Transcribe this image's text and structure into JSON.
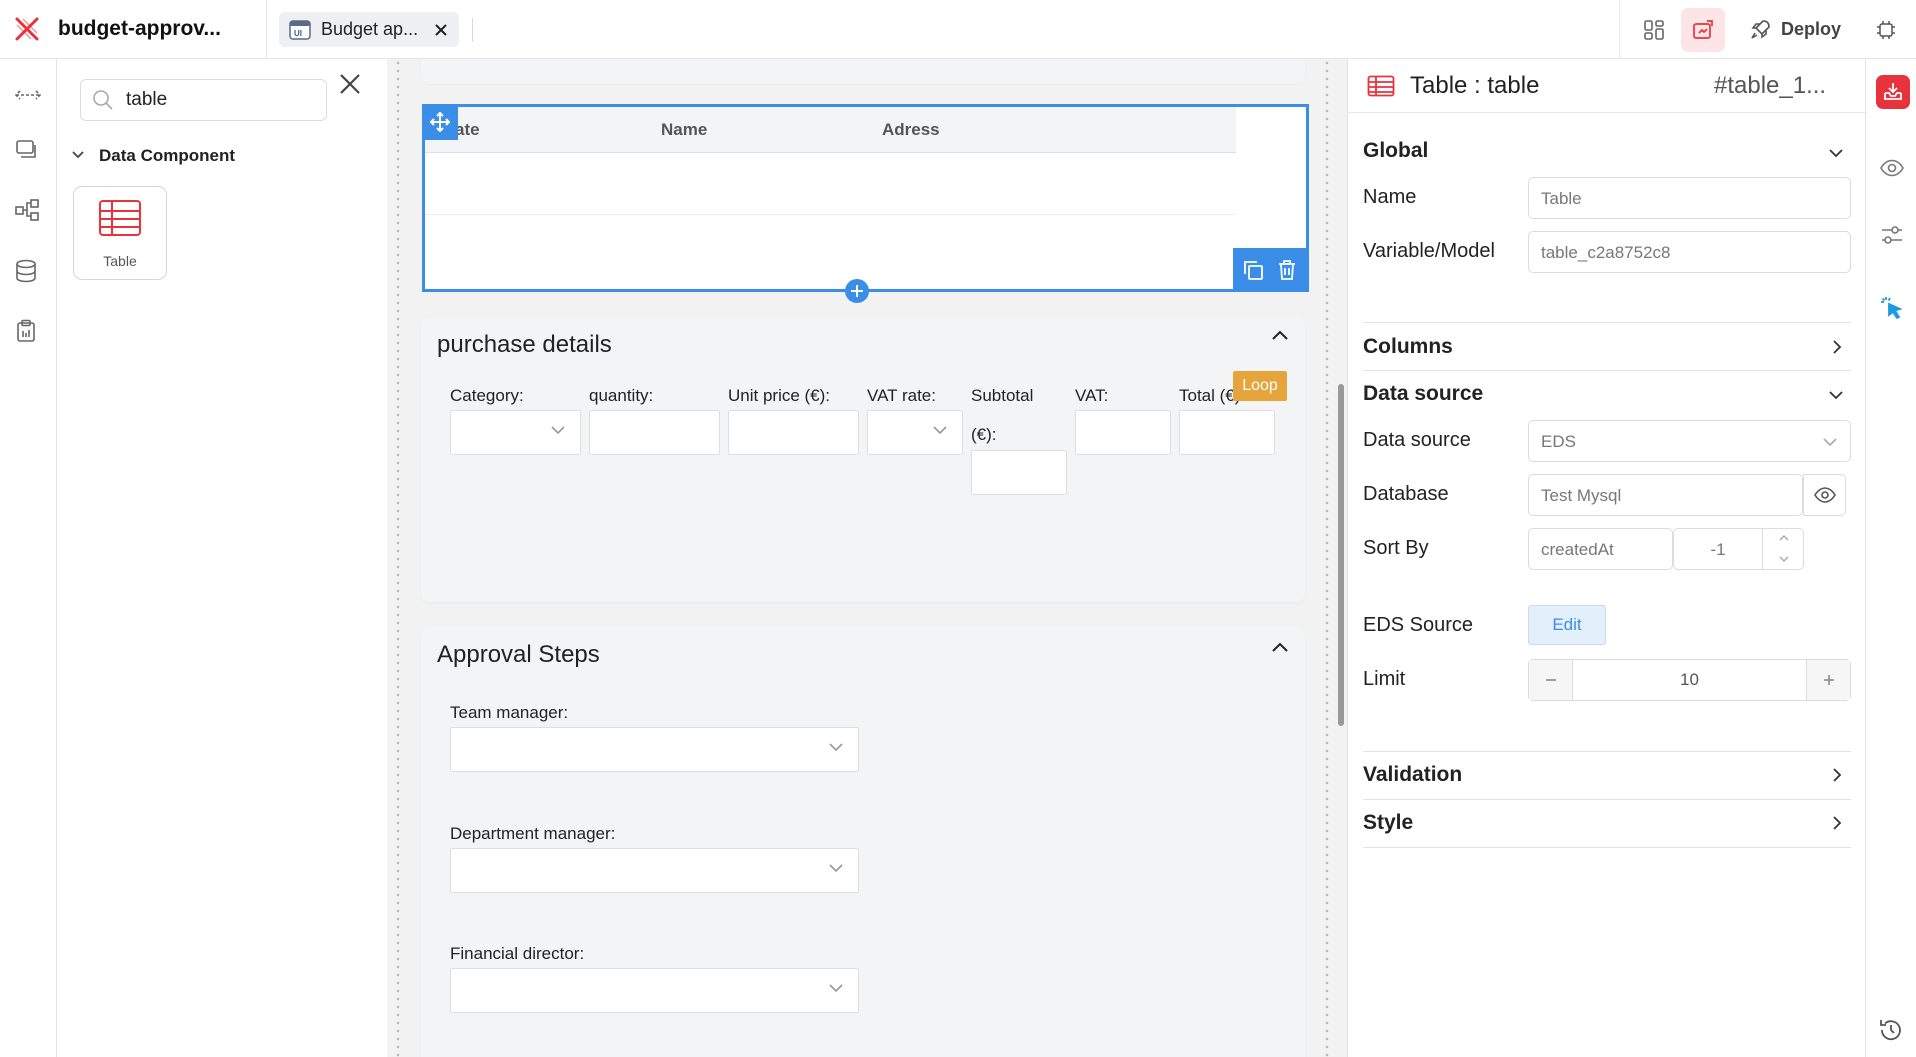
{
  "app": {
    "title": "budget-approv..."
  },
  "tab": {
    "label": "Budget ap..."
  },
  "toolbar": {
    "deploy_label": "Deploy"
  },
  "component_panel": {
    "search_value": "table",
    "section_title": "Data Component",
    "components": [
      {
        "label": "Table"
      }
    ]
  },
  "canvas": {
    "table": {
      "columns": [
        "ate",
        "Name",
        "Adress"
      ]
    },
    "purchase": {
      "title": "purchase details",
      "loop_badge": "Loop",
      "fields": {
        "category": "Category:",
        "quantity": "quantity:",
        "unit_price": "Unit price (€):",
        "vat_rate": "VAT rate:",
        "subtotal_1": "Subtotal",
        "subtotal_2": "(€):",
        "vat": "VAT:",
        "total": "Total (€):"
      }
    },
    "approval": {
      "title": "Approval Steps",
      "team_manager": "Team manager:",
      "department_manager": "Department manager:",
      "financial_director": "Financial director:"
    }
  },
  "properties": {
    "header_title": "Table : table",
    "header_id": "#table_1...",
    "global": {
      "title": "Global",
      "name_label": "Name",
      "name_value": "Table",
      "variable_label": "Variable/Model",
      "variable_value": "table_c2a8752c8"
    },
    "columns_title": "Columns",
    "data_source": {
      "title": "Data source",
      "source_label": "Data source",
      "source_value": "EDS",
      "database_label": "Database",
      "database_value": "Test Mysql",
      "sort_label": "Sort By",
      "sort_field": "createdAt",
      "sort_order": "-1",
      "eds_label": "EDS Source",
      "eds_button": "Edit",
      "limit_label": "Limit",
      "limit_value": "10"
    },
    "validation_title": "Validation",
    "style_title": "Style"
  },
  "colors": {
    "accent": "#3b8ee8",
    "brand_red": "#e8323c",
    "loop_badge": "#e6a53c"
  }
}
